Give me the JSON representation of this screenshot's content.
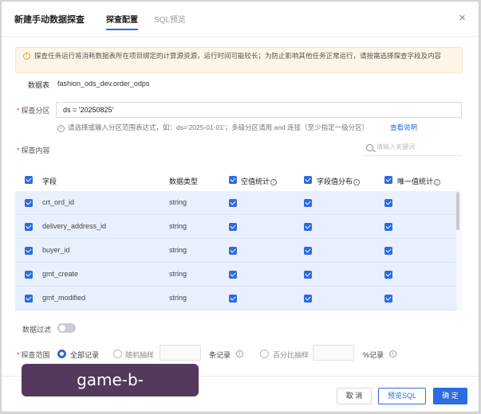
{
  "dialog": {
    "title": "新建手动数据探查",
    "tabs": [
      {
        "label": "探查配置",
        "active": true
      },
      {
        "label": "SQL预览",
        "active": false
      }
    ],
    "close_label": "×"
  },
  "notice": {
    "text": "探查任务运行将消耗数据表所在项目绑定的计算源资源，运行时间可能较长；为防止影响其他任务正常运行，请按需选择探查字段及内容"
  },
  "table_info": {
    "label": "数据表",
    "value": "fashion_ods_dev.order_odps"
  },
  "partition": {
    "label": "探查分区",
    "value": "ds = '20250825'",
    "hint": "请选择或输入分区范围表达式，如：ds='2025-01-01'；多级分区请用 and 连接（至少指定一级分区）",
    "hint_link": "查看说明"
  },
  "content": {
    "label": "探查内容",
    "search_placeholder": "请输入关键词",
    "columns": {
      "field": "字段",
      "type": "数据类型",
      "null_stat": "空值统计",
      "value_dist": "字段值分布",
      "unique_stat": "唯一值统计"
    },
    "rows": [
      {
        "field": "crt_ord_id",
        "type": "string"
      },
      {
        "field": "delivery_address_id",
        "type": "string"
      },
      {
        "field": "buyer_id",
        "type": "string"
      },
      {
        "field": "gmt_create",
        "type": "string"
      },
      {
        "field": "gmt_modified",
        "type": "string"
      }
    ]
  },
  "filter": {
    "label": "数据过滤",
    "enabled": false
  },
  "scope": {
    "label": "探查范围",
    "options": {
      "all": "全部记录",
      "random": "随机抽样",
      "percent": "百分比抽样"
    },
    "random_unit": "条记录",
    "percent_unit": "%记录",
    "selected": "all"
  },
  "footer": {
    "cancel": "取 消",
    "preview": "预览SQL",
    "ok": "确 定"
  },
  "watermark": "game-b-sports.com.cn",
  "colors": {
    "primary": "#2c6be0",
    "notice_bg": "#fdf5e6",
    "row_bg": "#e9f0fd"
  }
}
